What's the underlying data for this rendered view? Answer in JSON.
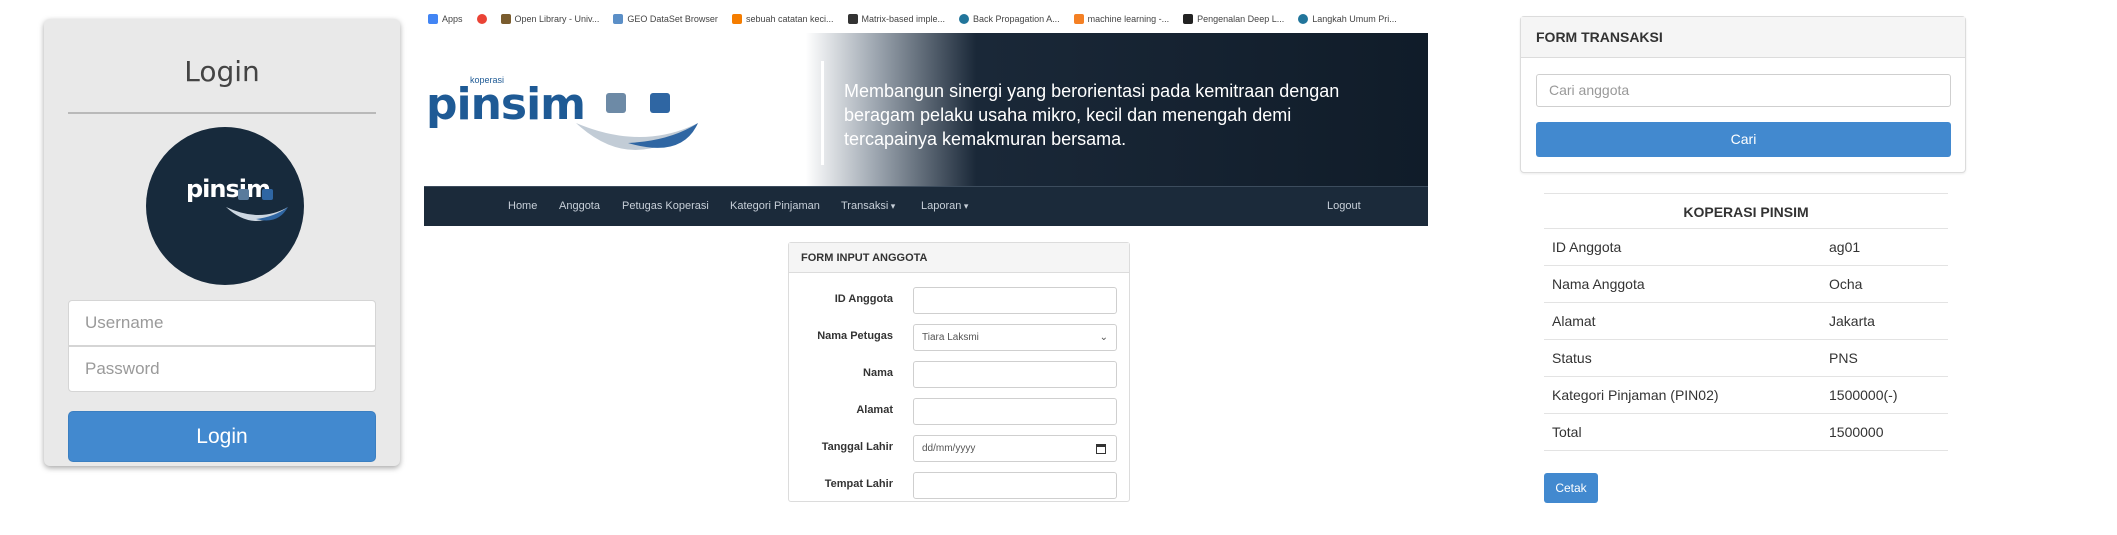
{
  "login": {
    "title": "Login",
    "logo_text": "pinsim",
    "username_placeholder": "Username",
    "password_placeholder": "Password",
    "button_label": "Login"
  },
  "browser": {
    "bookmarks": [
      {
        "label": "Apps",
        "icon": "apps-grid-icon",
        "color": "#4285f4"
      },
      {
        "label": "",
        "icon": "google-icon",
        "color": "#ea4335"
      },
      {
        "label": "Open Library - Univ...",
        "icon": "library-icon",
        "color": "#7a5c2e"
      },
      {
        "label": "GEO DataSet Browser",
        "icon": "dna-icon",
        "color": "#5b8fc7"
      },
      {
        "label": "sebuah catatan keci...",
        "icon": "blogger-icon",
        "color": "#f57d00"
      },
      {
        "label": "Matrix-based imple...",
        "icon": "doc-icon",
        "color": "#333333"
      },
      {
        "label": "Back Propagation A...",
        "icon": "wordpress-icon",
        "color": "#21759b"
      },
      {
        "label": "machine learning -...",
        "icon": "stack-icon",
        "color": "#f48024"
      },
      {
        "label": "Pengenalan Deep L...",
        "icon": "video-icon",
        "color": "#222222"
      },
      {
        "label": "Langkah Umum Pri...",
        "icon": "wordpress-icon",
        "color": "#21759b"
      }
    ]
  },
  "site": {
    "logo_small": "koperasi",
    "logo_text": "pinsim",
    "tagline": "Membangun sinergi yang berorientasi pada kemitraan dengan beragam pelaku usaha mikro, kecil dan menengah demi tercapainya kemakmuran bersama.",
    "nav": {
      "home": "Home",
      "anggota": "Anggota",
      "petugas": "Petugas Koperasi",
      "kategori": "Kategori Pinjaman",
      "transaksi": "Transaksi",
      "laporan": "Laporan",
      "logout": "Logout"
    },
    "colors": {
      "brand": "#1e5a95",
      "navbar": "#1b2a3a",
      "accent": "#4289cf"
    }
  },
  "form_anggota": {
    "title": "FORM INPUT ANGGOTA",
    "fields": {
      "id": {
        "label": "ID Anggota",
        "value": ""
      },
      "petugas": {
        "label": "Nama Petugas",
        "value": "Tiara Laksmi"
      },
      "nama": {
        "label": "Nama",
        "value": ""
      },
      "alamat": {
        "label": "Alamat",
        "value": ""
      },
      "tanggal": {
        "label": "Tanggal Lahir",
        "placeholder": "dd/mm/yyyy"
      },
      "tempat": {
        "label": "Tempat Lahir",
        "value": ""
      }
    }
  },
  "form_transaksi": {
    "title": "FORM TRANSAKSI",
    "search_placeholder": "Cari anggota",
    "button_label": "Cari"
  },
  "receipt": {
    "title": "KOPERASI PINSIM",
    "rows": [
      {
        "key": "ID Anggota",
        "value": "ag01"
      },
      {
        "key": "Nama Anggota",
        "value": "Ocha"
      },
      {
        "key": "Alamat",
        "value": "Jakarta"
      },
      {
        "key": "Status",
        "value": "PNS"
      },
      {
        "key": "Kategori Pinjaman (PIN02)",
        "value": "1500000(-)"
      },
      {
        "key": "Total",
        "value": "1500000"
      }
    ],
    "print_label": "Cetak"
  }
}
